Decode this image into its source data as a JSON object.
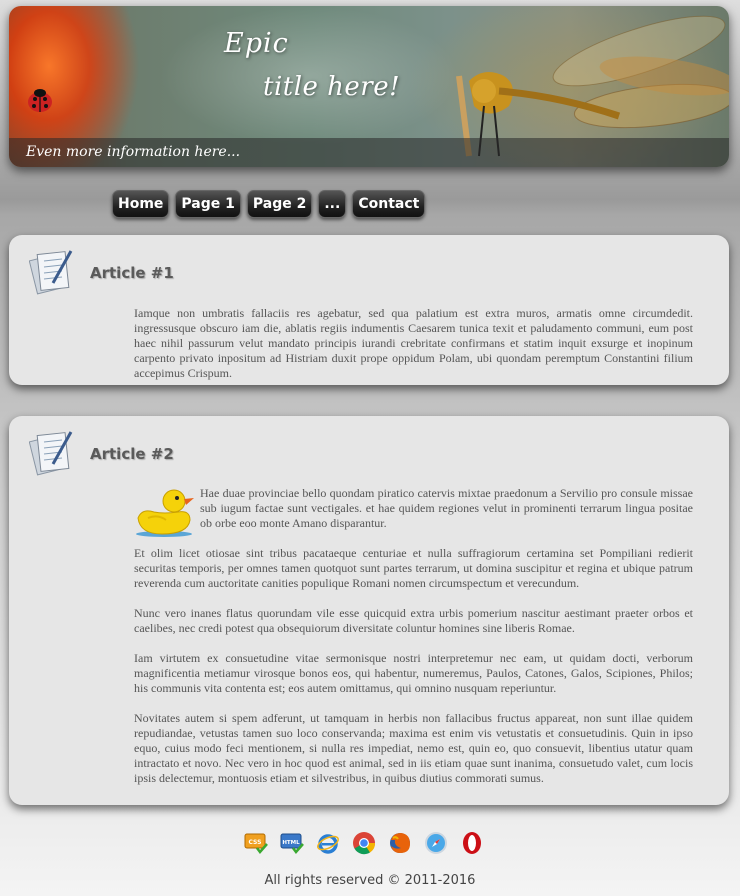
{
  "header": {
    "title_line1": "Epic",
    "title_line2": "title here!",
    "subtitle": "Even more information here..."
  },
  "nav": {
    "items": [
      {
        "label": "Home"
      },
      {
        "label": "Page 1"
      },
      {
        "label": "Page 2"
      },
      {
        "label": "..."
      },
      {
        "label": "Contact"
      }
    ]
  },
  "articles": [
    {
      "title": "Article #1",
      "paragraphs": [
        "Iamque non umbratis fallaciis res agebatur, sed qua palatium est extra muros, armatis omne circumdedit. ingressusque obscuro iam die, ablatis regiis indumentis Caesarem tunica texit et paludamento communi, eum post haec nihil passurum velut mandato principis iurandi crebritate confirmans et statim inquit exsurge et inopinum carpento privato inpositum ad Histriam duxit prope oppidum Polam, ubi quondam peremptum Constantini filium accepimus Crispum."
      ]
    },
    {
      "title": "Article #2",
      "paragraphs": [
        "Hae duae provinciae bello quondam piratico catervis mixtae praedonum a Servilio pro consule missae sub iugum factae sunt vectigales. et hae quidem regiones velut in prominenti terrarum lingua positae ob orbe eoo monte Amano disparantur.",
        "Et olim licet otiosae sint tribus pacataeque centuriae et nulla suffragiorum certamina set Pompiliani redierit securitas temporis, per omnes tamen quotquot sunt partes terrarum, ut domina suscipitur et regina et ubique patrum reverenda cum auctoritate canities populique Romani nomen circumspectum et verecundum.",
        "Nunc vero inanes flatus quorundam vile esse quicquid extra urbis pomerium nascitur aestimant praeter orbos et caelibes, nec credi potest qua obsequiorum diversitate coluntur homines sine liberis Romae.",
        "Iam virtutem ex consuetudine vitae sermonisque nostri interpretemur nec eam, ut quidam docti, verborum magnificentia metiamur virosque bonos eos, qui habentur, numeremus, Paulos, Catones, Galos, Scipiones, Philos; his communis vita contenta est; eos autem omittamus, qui omnino nusquam reperiuntur.",
        "Novitates autem si spem adferunt, ut tamquam in herbis non fallacibus fructus appareat, non sunt illae quidem repudiandae, vetustas tamen suo loco conservanda; maxima est enim vis vetustatis et consuetudinis. Quin in ipso equo, cuius modo feci mentionem, si nulla res impediat, nemo est, quin eo, quo consuevit, libentius utatur quam intractato et novo. Nec vero in hoc quod est animal, sed in iis etiam quae sunt inanima, consuetudo valet, cum locis ipsis delectemur, montuosis etiam et silvestribus, in quibus diutius commorati sumus."
      ]
    }
  ],
  "badges": [
    {
      "label": "CSS",
      "icon": "css-valid-icon"
    },
    {
      "label": "HTML",
      "icon": "html-valid-icon"
    },
    {
      "label": "",
      "icon": "internet-explorer-icon"
    },
    {
      "label": "",
      "icon": "chrome-icon"
    },
    {
      "label": "",
      "icon": "firefox-icon"
    },
    {
      "label": "",
      "icon": "safari-icon"
    },
    {
      "label": "",
      "icon": "opera-icon"
    }
  ],
  "footer": {
    "text": "All rights reserved © 2011-2016"
  }
}
